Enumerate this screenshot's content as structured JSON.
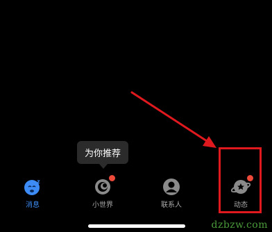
{
  "tooltip": {
    "text": "为你推荐"
  },
  "tabbar": {
    "tabs": [
      {
        "label": "消息",
        "icon": "message-qq-icon",
        "active": true,
        "badge": false
      },
      {
        "label": "小世界",
        "icon": "small-world-icon",
        "active": false,
        "badge": true
      },
      {
        "label": "联系人",
        "icon": "contacts-icon",
        "active": false,
        "badge": false
      },
      {
        "label": "动态",
        "icon": "planet-icon",
        "active": false,
        "badge": true
      }
    ]
  },
  "watermark": {
    "text": "dzbzw.com"
  },
  "colors": {
    "background": "#000000",
    "active": "#3d8cf5",
    "inactive": "#a8a8a8",
    "badge": "#ee4a3a",
    "annotation": "#e0191f"
  }
}
